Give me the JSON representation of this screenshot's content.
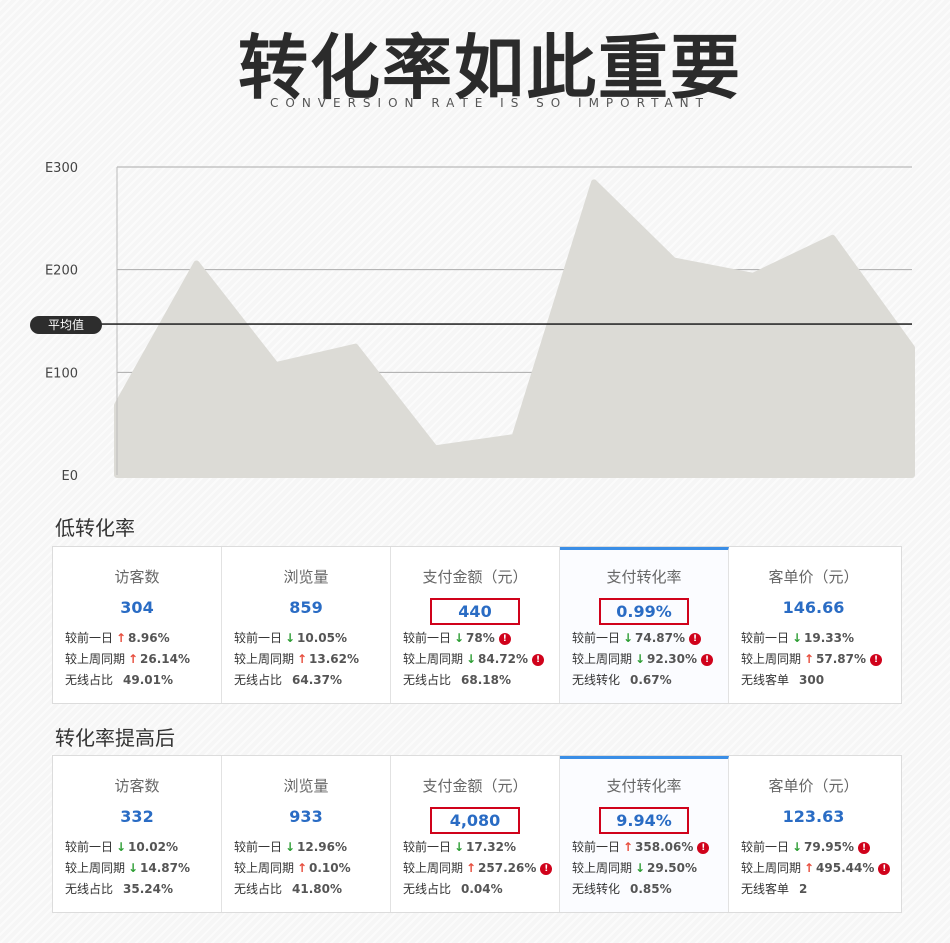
{
  "header": {
    "title": "转化率如此重要",
    "subtitle": "CONVERSION RATE IS SO IMPORTANT"
  },
  "chart_data": {
    "type": "area",
    "y_ticks": [
      "E0",
      "E100",
      "E200",
      "E300"
    ],
    "ylim": [
      0,
      300
    ],
    "values": [
      68,
      206,
      107,
      125,
      26,
      37,
      285,
      209,
      194,
      231,
      124
    ],
    "average_label": "平均值",
    "average": 147,
    "grid": true,
    "colors": {
      "area": "#dcdbd6",
      "grid": "#aaaaaa",
      "average": "#2d2d2d"
    }
  },
  "sections": [
    {
      "title": "低转化率",
      "cells": [
        {
          "title": "访客数",
          "value": "304",
          "highlight": false,
          "active": false,
          "rows": [
            {
              "label": "较前一日",
              "dir": "up",
              "pct": "8.96%",
              "warn": false
            },
            {
              "label": "较上周同期",
              "dir": "up",
              "pct": "26.14%",
              "warn": false
            },
            {
              "label": "无线占比",
              "dir": "",
              "pct": "49.01%",
              "warn": false
            }
          ]
        },
        {
          "title": "浏览量",
          "value": "859",
          "highlight": false,
          "active": false,
          "rows": [
            {
              "label": "较前一日",
              "dir": "down",
              "pct": "10.05%",
              "warn": false
            },
            {
              "label": "较上周同期",
              "dir": "up",
              "pct": "13.62%",
              "warn": false
            },
            {
              "label": "无线占比",
              "dir": "",
              "pct": "64.37%",
              "warn": false
            }
          ]
        },
        {
          "title": "支付金额（元）",
          "value": "440",
          "highlight": true,
          "active": false,
          "rows": [
            {
              "label": "较前一日",
              "dir": "down",
              "pct": "78%",
              "warn": true
            },
            {
              "label": "较上周同期",
              "dir": "down",
              "pct": "84.72%",
              "warn": true
            },
            {
              "label": "无线占比",
              "dir": "",
              "pct": "68.18%",
              "warn": false
            }
          ]
        },
        {
          "title": "支付转化率",
          "value": "0.99%",
          "highlight": true,
          "active": true,
          "rows": [
            {
              "label": "较前一日",
              "dir": "down",
              "pct": "74.87%",
              "warn": true
            },
            {
              "label": "较上周同期",
              "dir": "down",
              "pct": "92.30%",
              "warn": true
            },
            {
              "label": "无线转化",
              "dir": "",
              "pct": "0.67%",
              "warn": false
            }
          ]
        },
        {
          "title": "客单价（元）",
          "value": "146.66",
          "highlight": false,
          "active": false,
          "rows": [
            {
              "label": "较前一日",
              "dir": "down",
              "pct": "19.33%",
              "warn": false
            },
            {
              "label": "较上周同期",
              "dir": "up",
              "pct": "57.87%",
              "warn": true
            },
            {
              "label": "无线客单",
              "dir": "",
              "pct": "300",
              "warn": false
            }
          ]
        }
      ]
    },
    {
      "title": "转化率提高后",
      "cells": [
        {
          "title": "访客数",
          "value": "332",
          "highlight": false,
          "active": false,
          "rows": [
            {
              "label": "较前一日",
              "dir": "down",
              "pct": "10.02%",
              "warn": false
            },
            {
              "label": "较上周同期",
              "dir": "down",
              "pct": "14.87%",
              "warn": false
            },
            {
              "label": "无线占比",
              "dir": "",
              "pct": "35.24%",
              "warn": false
            }
          ]
        },
        {
          "title": "浏览量",
          "value": "933",
          "highlight": false,
          "active": false,
          "rows": [
            {
              "label": "较前一日",
              "dir": "down",
              "pct": "12.96%",
              "warn": false
            },
            {
              "label": "较上周同期",
              "dir": "up",
              "pct": "0.10%",
              "warn": false
            },
            {
              "label": "无线占比",
              "dir": "",
              "pct": "41.80%",
              "warn": false
            }
          ]
        },
        {
          "title": "支付金额（元）",
          "value": "4,080",
          "highlight": true,
          "active": false,
          "rows": [
            {
              "label": "较前一日",
              "dir": "down",
              "pct": "17.32%",
              "warn": false
            },
            {
              "label": "较上周同期",
              "dir": "up",
              "pct": "257.26%",
              "warn": true
            },
            {
              "label": "无线占比",
              "dir": "",
              "pct": "0.04%",
              "warn": false
            }
          ]
        },
        {
          "title": "支付转化率",
          "value": "9.94%",
          "highlight": true,
          "active": true,
          "rows": [
            {
              "label": "较前一日",
              "dir": "up",
              "pct": "358.06%",
              "warn": true
            },
            {
              "label": "较上周同期",
              "dir": "down",
              "pct": "29.50%",
              "warn": false
            },
            {
              "label": "无线转化",
              "dir": "",
              "pct": "0.85%",
              "warn": false
            }
          ]
        },
        {
          "title": "客单价（元）",
          "value": "123.63",
          "highlight": false,
          "active": false,
          "rows": [
            {
              "label": "较前一日",
              "dir": "down",
              "pct": "79.95%",
              "warn": true
            },
            {
              "label": "较上周同期",
              "dir": "up",
              "pct": "495.44%",
              "warn": true
            },
            {
              "label": "无线客单",
              "dir": "",
              "pct": "2",
              "warn": false
            }
          ]
        }
      ]
    }
  ]
}
